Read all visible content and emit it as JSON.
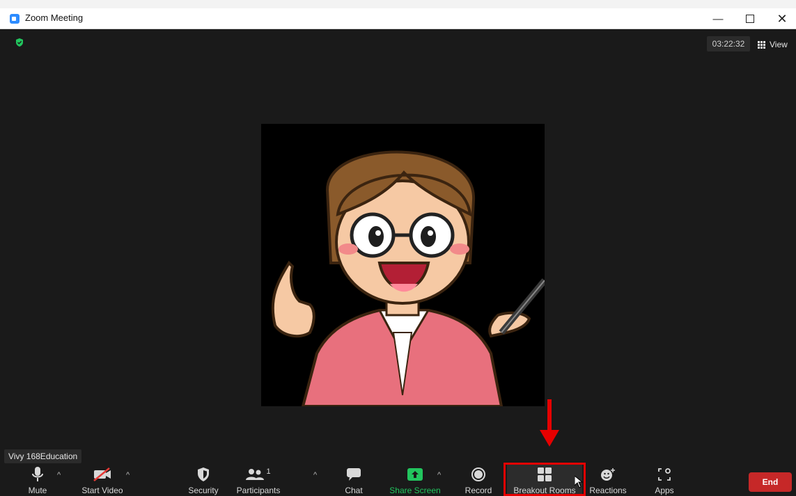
{
  "window": {
    "title": "Zoom Meeting",
    "controls": {
      "minimize": "—",
      "close": "✕"
    }
  },
  "meeting": {
    "timer": "03:22:32",
    "view_label": "View",
    "participant_name": "Vivy 168Education"
  },
  "toolbar": {
    "mute_label": "Mute",
    "start_video_label": "Start Video",
    "security_label": "Security",
    "participants_label": "Participants",
    "participants_count": "1",
    "chat_label": "Chat",
    "share_screen_label": "Share Screen",
    "record_label": "Record",
    "breakout_rooms_label": "Breakout Rooms",
    "reactions_label": "Reactions",
    "apps_label": "Apps",
    "end_label": "End",
    "caret": "^"
  },
  "colors": {
    "accent_share": "#22c55e",
    "annotation_red": "#e60000",
    "end_red": "#c62828",
    "security_shield": "#22c55e"
  }
}
